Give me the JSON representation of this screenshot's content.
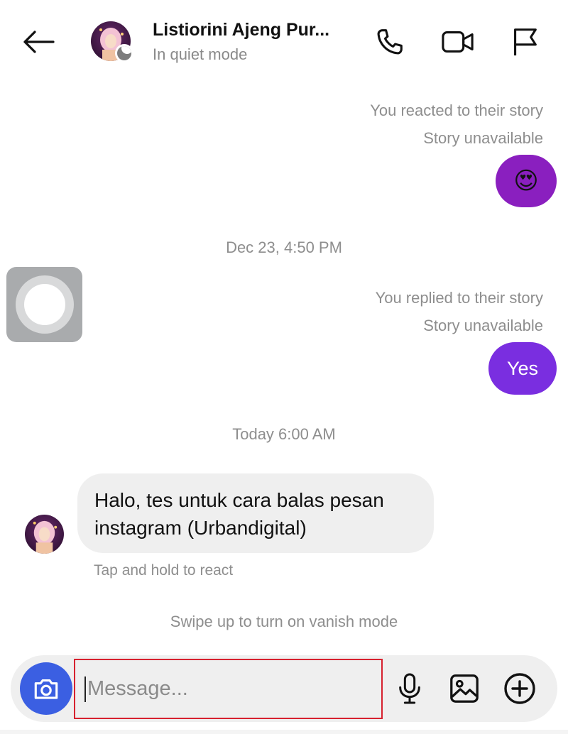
{
  "header": {
    "contact_name": "Listiorini Ajeng Pur...",
    "status": "In quiet mode",
    "icons": [
      "back-arrow-icon",
      "phone-icon",
      "video-camera-icon",
      "flag-icon"
    ]
  },
  "messages": {
    "story_reaction_1": {
      "label": "You reacted to their story",
      "status": "Story unavailable",
      "reaction": "😍"
    },
    "timestamp_1": "Dec 23, 4:50 PM",
    "story_reply_1": {
      "label": "You replied to their story",
      "status": "Story unavailable",
      "text": "Yes"
    },
    "timestamp_2": "Today 6:00 AM",
    "received_1": {
      "text": "Halo, tes untuk cara balas pesan instagram (Urbandigital)",
      "hint": "Tap and hold to react"
    },
    "vanish_hint": "Swipe up to turn on vanish mode"
  },
  "composer": {
    "placeholder": "Message...",
    "icons": [
      "camera-icon",
      "microphone-icon",
      "gallery-icon",
      "plus-icon"
    ]
  },
  "colors": {
    "accent_blue": "#3b5fe2",
    "sent_bubble": "#7a2ee0",
    "reaction_bubble": "#8a1fbf",
    "highlight_box": "#d7212f"
  }
}
